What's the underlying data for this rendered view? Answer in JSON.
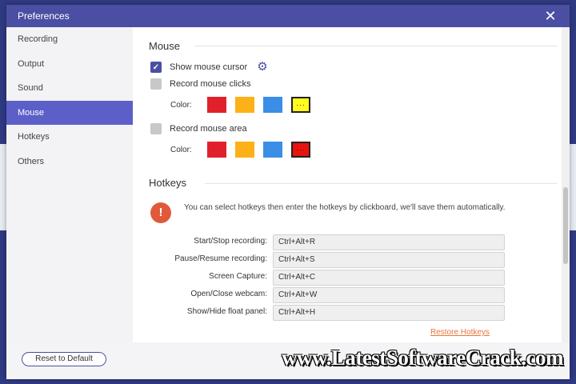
{
  "window": {
    "title": "Preferences"
  },
  "sidebar": {
    "items": [
      {
        "label": "Recording"
      },
      {
        "label": "Output"
      },
      {
        "label": "Sound"
      },
      {
        "label": "Mouse",
        "active": true
      },
      {
        "label": "Hotkeys"
      },
      {
        "label": "Others"
      }
    ]
  },
  "mouse": {
    "title": "Mouse",
    "show_cursor": {
      "label": "Show mouse cursor",
      "checked": true
    },
    "record_clicks": {
      "label": "Record mouse clicks",
      "checked": false,
      "color_label": "Color:",
      "selected_marker": "···"
    },
    "record_area": {
      "label": "Record mouse area",
      "checked": false,
      "color_label": "Color:",
      "selected_marker": "···"
    },
    "colors": [
      "#e0212b",
      "#fbb117",
      "#3a8ee6"
    ],
    "clicks_selected_color": "#fffc1e",
    "area_selected_color": "#e8120e"
  },
  "hotkeys": {
    "title": "Hotkeys",
    "info": "You can select hotkeys then enter the hotkeys by clickboard, we'll save them automatically.",
    "rows": [
      {
        "label": "Start/Stop recording:",
        "value": "Ctrl+Alt+R"
      },
      {
        "label": "Pause/Resume recording:",
        "value": "Ctrl+Alt+S"
      },
      {
        "label": "Screen Capture:",
        "value": "Ctrl+Alt+C"
      },
      {
        "label": "Open/Close webcam:",
        "value": "Ctrl+Alt+W"
      },
      {
        "label": "Show/Hide float panel:",
        "value": "Ctrl+Alt+H"
      }
    ],
    "restore_label": "Restore Hotkeys"
  },
  "footer": {
    "reset_label": "Reset to Default"
  },
  "watermark": "www.LatestSoftwareCrack.com"
}
